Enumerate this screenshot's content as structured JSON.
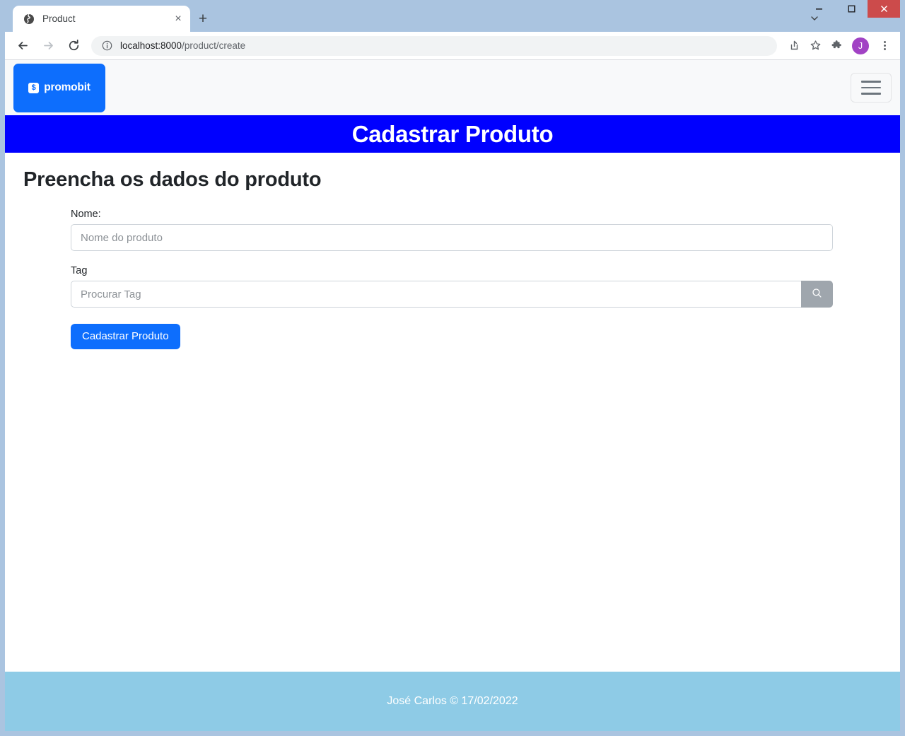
{
  "browser": {
    "tab": {
      "title": "Product",
      "favicon": "globe-icon",
      "close": "×"
    },
    "new_tab_label": "+",
    "window_controls": {
      "minimize": "–",
      "maximize": "❐",
      "close": "✕"
    },
    "toolbar": {
      "back": "←",
      "forward": "→",
      "reload": "↻",
      "url_host": "localhost:8000",
      "url_path": "/product/create",
      "share_icon": "share-icon",
      "bookmark_icon": "star-icon",
      "extensions_icon": "puzzle-icon",
      "profile_initial": "J",
      "menu_icon": "three-dot-menu-icon"
    }
  },
  "site": {
    "brand": {
      "mark": "$",
      "name": "promobit"
    },
    "toggler_label": "navbar-toggler",
    "banner_title": "Cadastrar Produto",
    "page_heading": "Preencha os dados do produto",
    "form": {
      "name_label": "Nome:",
      "name_placeholder": "Nome do produto",
      "name_value": "",
      "tag_label": "Tag",
      "tag_placeholder": "Procurar Tag",
      "tag_value": "",
      "search_icon": "search-icon",
      "submit_label": "Cadastrar Produto"
    },
    "footer_text": "José Carlos © 17/02/2022"
  },
  "colors": {
    "brand_blue": "#0d6efd",
    "banner_blue": "#0000ff",
    "footer_blue": "#8ecbe6",
    "avatar_purple": "#a142c4",
    "close_red": "#cc4b4b"
  }
}
